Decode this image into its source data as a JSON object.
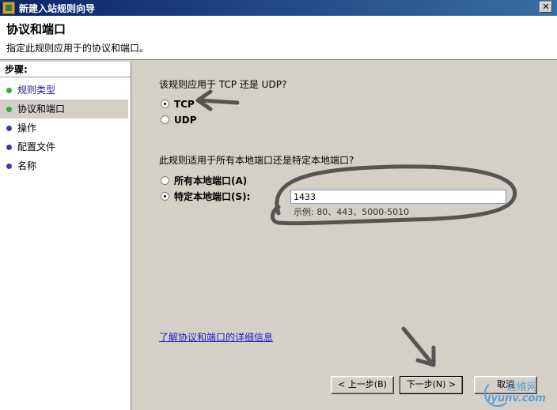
{
  "window": {
    "title": "新建入站规则向导",
    "close_label": "✕"
  },
  "header": {
    "title": "协议和端口",
    "description": "指定此规则应用于的协议和端口。"
  },
  "sidebar": {
    "steps_label": "步骤:",
    "items": [
      {
        "label": "规则类型"
      },
      {
        "label": "协议和端口"
      },
      {
        "label": "操作"
      },
      {
        "label": "配置文件"
      },
      {
        "label": "名称"
      }
    ]
  },
  "protocol": {
    "question": "该规则应用于 TCP 还是 UDP?",
    "options": [
      {
        "label": "TCP",
        "checked": true
      },
      {
        "label": "UDP",
        "checked": false
      }
    ]
  },
  "ports": {
    "question": "此规则适用于所有本地端口还是特定本地端口?",
    "options": [
      {
        "label": "所有本地端口(A)",
        "checked": false
      },
      {
        "label": "特定本地端口(S):",
        "checked": true
      }
    ],
    "value": "1433",
    "example": "示例: 80、443、5000-5010"
  },
  "link": {
    "label": "了解协议和端口的详细信息"
  },
  "buttons": {
    "back": "< 上一步(B)",
    "next": "下一步(N) >",
    "cancel": "取消"
  },
  "watermark": {
    "top": "运维网",
    "bottom": "iyunv.com"
  },
  "colors": {
    "title_bar": "#0a246a",
    "annotation_stroke": "#404040",
    "link": "#1a1acc"
  }
}
